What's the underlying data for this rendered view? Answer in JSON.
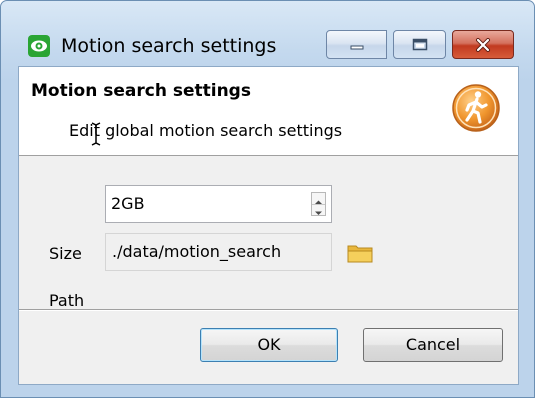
{
  "window": {
    "title": "Motion search settings",
    "app_icon": "eye-icon"
  },
  "caption_buttons": {
    "minimize_icon": "minimize-icon",
    "maximize_icon": "maximize-icon",
    "close_icon": "close-icon"
  },
  "header": {
    "title": "Motion search settings",
    "subtitle": "Edit global motion search settings",
    "icon": "walking-person-icon",
    "icon_color": "#f0962e"
  },
  "form": {
    "size_label": "Size",
    "size_value": "2GB",
    "path_label": "Path",
    "path_value": "./data/motion_search",
    "browse_icon": "folder-icon"
  },
  "buttons": {
    "ok_label": "OK",
    "cancel_label": "Cancel"
  },
  "colors": {
    "title_bar": "#c4d9ee",
    "close_button": "#c13a20",
    "default_button_border": "#3c7fb1",
    "folder": "#f5cf5c"
  }
}
